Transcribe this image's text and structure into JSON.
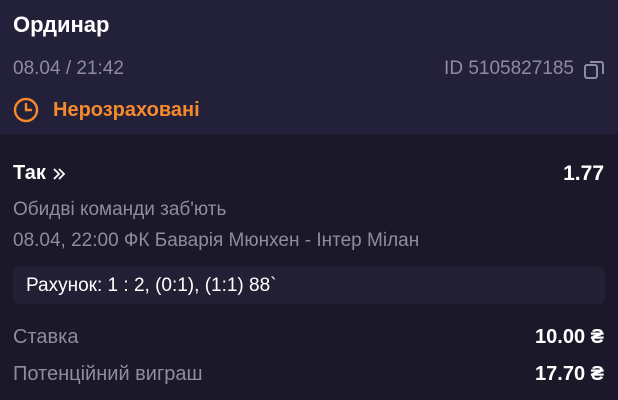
{
  "header": {
    "title": "Ординар",
    "datetime": "08.04 / 21:42",
    "ticket_id": "ID 5105827185",
    "status": "Нерозраховані"
  },
  "selection": {
    "pick": "Так",
    "odds": "1.77",
    "market": "Обидві команди заб'ють",
    "event": "08.04, 22:00 ФК Баварія Мюнхен - Інтер Мілан",
    "score": "Рахунок: 1 : 2, (0:1), (1:1) 88`"
  },
  "summary": {
    "stake_label": "Ставка",
    "stake_value": "10.00 ₴",
    "win_label": "Потенційний виграш",
    "win_value": "17.70 ₴"
  },
  "colors": {
    "accent": "#f5892c",
    "muted": "#8e8ca1",
    "header_bg": "#23203a",
    "body_bg": "#1b1829"
  },
  "icons": [
    "clock-icon",
    "copy-icon",
    "double-chevron-right-icon"
  ]
}
